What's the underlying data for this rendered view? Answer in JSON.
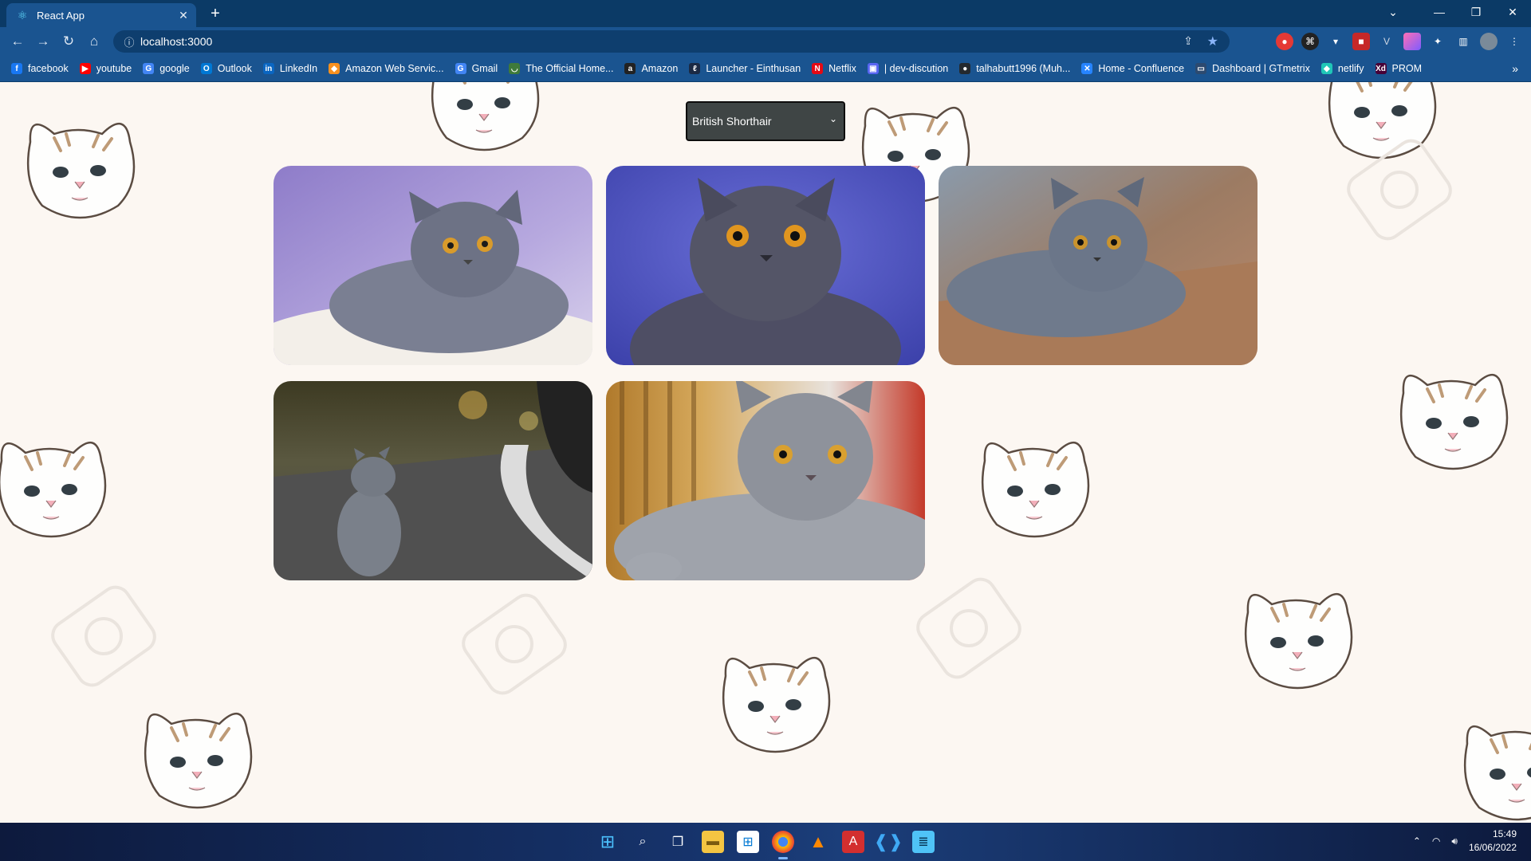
{
  "browser": {
    "tab_title": "React App",
    "url": "localhost:3000",
    "bookmarks": [
      {
        "label": "facebook",
        "icon": "facebook-icon",
        "color": "#1877f2",
        "glyph": "f"
      },
      {
        "label": "youtube",
        "icon": "youtube-icon",
        "color": "#ff0000",
        "glyph": "▶"
      },
      {
        "label": "google",
        "icon": "google-icon",
        "color": "#4285f4",
        "glyph": "G"
      },
      {
        "label": "Outlook",
        "icon": "outlook-icon",
        "color": "#0078d4",
        "glyph": "O"
      },
      {
        "label": "LinkedIn",
        "icon": "linkedin-icon",
        "color": "#0a66c2",
        "glyph": "in"
      },
      {
        "label": "Amazon Web Servic...",
        "icon": "aws-icon",
        "color": "#f7901e",
        "glyph": "◆"
      },
      {
        "label": "Gmail",
        "icon": "gmail-icon",
        "color": "#4285f4",
        "glyph": "G"
      },
      {
        "label": "The Official Home...",
        "icon": "official-home-icon",
        "color": "#3f7a3a",
        "glyph": "◡"
      },
      {
        "label": "Amazon",
        "icon": "amazon-icon",
        "color": "#222222",
        "glyph": "a"
      },
      {
        "label": "Launcher - Einthusan",
        "icon": "einthusan-icon",
        "color": "#1b2a44",
        "glyph": "ℓ"
      },
      {
        "label": "Netflix",
        "icon": "netflix-icon",
        "color": "#e50914",
        "glyph": "N"
      },
      {
        "label": "| dev-discution",
        "icon": "dev-discution-icon",
        "color": "#5865f2",
        "glyph": "▣"
      },
      {
        "label": "talhabutt1996 (Muh...",
        "icon": "github-icon",
        "color": "#24292e",
        "glyph": "●"
      },
      {
        "label": "Home - Confluence",
        "icon": "confluence-icon",
        "color": "#2684ff",
        "glyph": "✕"
      },
      {
        "label": "Dashboard | GTmetrix",
        "icon": "gtmetrix-icon",
        "color": "#2c4a70",
        "glyph": "▭"
      },
      {
        "label": "netlify",
        "icon": "netlify-icon",
        "color": "#20c6b7",
        "glyph": "◆"
      },
      {
        "label": "PROM",
        "icon": "xd-icon",
        "color": "#470137",
        "glyph": "Xd"
      }
    ]
  },
  "app": {
    "breed_select": {
      "selected": "British Shorthair"
    },
    "images": [
      {
        "alt": "british-shorthair-photo-1"
      },
      {
        "alt": "british-shorthair-photo-2"
      },
      {
        "alt": "british-shorthair-photo-3"
      },
      {
        "alt": "british-shorthair-photo-4"
      },
      {
        "alt": "british-shorthair-photo-5"
      }
    ]
  },
  "taskbar": {
    "time": "15:49",
    "date": "16/06/2022"
  }
}
